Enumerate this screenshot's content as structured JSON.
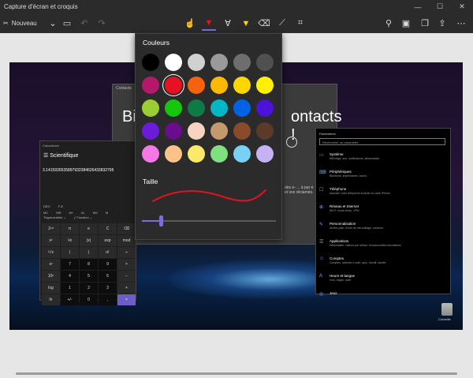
{
  "window": {
    "title": "Capture d'écran et croquis",
    "minimize": "—",
    "maximize": "☐",
    "close": "✕"
  },
  "toolbar": {
    "new_label": "Nouveau",
    "icons": [
      "touch-writing-icon",
      "ballpoint-pen-icon",
      "pencil-icon",
      "highlighter-icon",
      "eraser-icon",
      "ruler-icon",
      "crop-icon",
      "zoom-icon",
      "save-icon",
      "copy-icon",
      "share-icon",
      "more-icon"
    ]
  },
  "popup": {
    "colors_label": "Couleurs",
    "size_label": "Taille",
    "colors": [
      "#000000",
      "#ffffff",
      "#d1d1d1",
      "#9a9a9a",
      "#6e6e6e",
      "#505050",
      "#b4186a",
      "#e81123",
      "#f7630c",
      "#ffb900",
      "#ffd700",
      "#fff100",
      "#9acd32",
      "#16c60c",
      "#0e7a45",
      "#00b7c3",
      "#0063e5",
      "#4b12d8",
      "#6b1cd8",
      "#6a0d8a",
      "#f7d3c2",
      "#c49a6c",
      "#8a4b2a",
      "#5c3a2a",
      "#f678e7",
      "#fcc28a",
      "#fce96a",
      "#7ee07e",
      "#79d0f5",
      "#c6b1f5"
    ],
    "selected_color": "#e81123",
    "slider_accent": "#7b6fd4"
  },
  "desktop": {
    "bg_window_title": "Contacts",
    "bg_window_heading_left": "Bie",
    "bg_window_heading_right": "ontacts !",
    "bg_window_text": "des e- ...\nà par\ne et vos\nréclamés."
  },
  "calculator": {
    "title": "Calculatrice",
    "mode": "Scientifique",
    "display": "3.14159265358979323846264338327​95",
    "memory": [
      "DEG",
      "F-E",
      "",
      "MC",
      "MR",
      "M+",
      "M-",
      "MS",
      "M"
    ],
    "row_labels": [
      "Trigonométrie ⌄",
      "ƒ Fonction ⌄"
    ],
    "keys": [
      "2ⁿᵈ",
      "π",
      "e",
      "C",
      "⌫",
      "x²",
      "⅟x",
      "|x|",
      "exp",
      "mod",
      "²√x",
      "(",
      ")",
      "n!",
      "÷",
      "xʸ",
      "7",
      "8",
      "9",
      "×",
      "10ˣ",
      "4",
      "5",
      "6",
      "−",
      "log",
      "1",
      "2",
      "3",
      "+",
      "ln",
      "+/-",
      "0",
      ",",
      "="
    ]
  },
  "settings": {
    "title": "Paramètres",
    "search_placeholder": "Rechercher un paramètre",
    "items": [
      {
        "icon": "▭",
        "name": "Système",
        "desc": "Affichage, son, notifications, alimentation"
      },
      {
        "icon": "⌨",
        "name": "Périphériques",
        "desc": "Bluetooth, imprimantes, souris"
      },
      {
        "icon": "☐",
        "name": "Téléphone",
        "desc": "Associer votre téléphone Android ou votre iPhone"
      },
      {
        "icon": "⊕",
        "name": "Réseau et Internet",
        "desc": "Wi-Fi, mode Avion, VPN"
      },
      {
        "icon": "✎",
        "name": "Personnalisation",
        "desc": "Arrière-plan, écran de verrouillage, couleurs"
      },
      {
        "icon": "☰",
        "name": "Applications",
        "desc": "Désinstaller, valeurs par défaut, fonctionnalités facultatives"
      },
      {
        "icon": "☺",
        "name": "Comptes",
        "desc": "Comptes, adresse e-mail, sync, travail, famille"
      },
      {
        "icon": "A",
        "name": "Heure et langue",
        "desc": "Voix, région, date"
      },
      {
        "icon": "◎",
        "name": "Jeux",
        "desc": ""
      }
    ]
  },
  "recycle_bin_label": "Corbeille"
}
